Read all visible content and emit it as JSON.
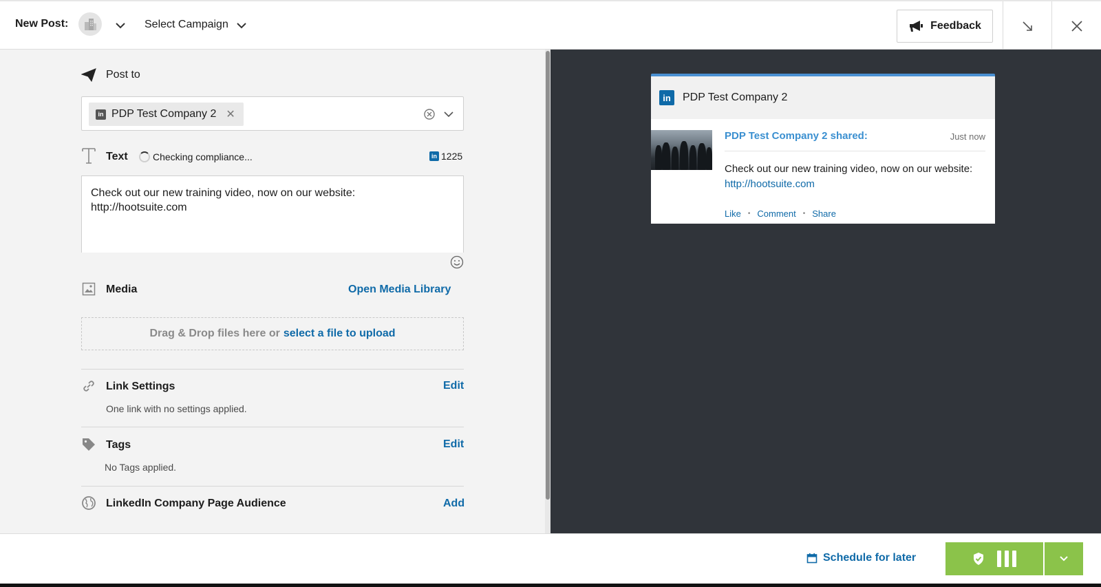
{
  "header": {
    "title": "New Post:",
    "avatar_icon": "building-icon",
    "campaign_label": "Select Campaign",
    "feedback_label": "Feedback"
  },
  "composer": {
    "post_to": {
      "label": "Post to",
      "selected_profile": "PDP Test Company 2"
    },
    "text": {
      "label": "Text",
      "compliance_status": "Checking compliance...",
      "char_count": "1225",
      "value": "Check out our new training video, now on our website:\nhttp://hootsuite.com"
    },
    "media": {
      "label": "Media",
      "library_link": "Open Media Library",
      "dropzone_text": "Drag & Drop files here or",
      "dropzone_link": "select a file to upload"
    },
    "link_settings": {
      "label": "Link Settings",
      "action": "Edit",
      "summary": "One link with no settings applied."
    },
    "tags": {
      "label": "Tags",
      "action": "Edit",
      "summary": "No Tags applied."
    },
    "audience": {
      "label": "LinkedIn Company Page Audience",
      "action": "Add"
    }
  },
  "preview": {
    "profile_name": "PDP Test Company 2",
    "shared_text": "PDP Test Company 2 shared:",
    "time": "Just now",
    "body": "Check out our new training video, now on our website:",
    "url": "http://hootsuite.com",
    "actions": [
      "Like",
      "Comment",
      "Share"
    ]
  },
  "footer": {
    "schedule_label": "Schedule for later"
  },
  "colors": {
    "accent_blue": "#0f6aa8",
    "preview_bg": "#30343a",
    "primary_green": "#8bc34a",
    "linkedin_blue": "#0f6aa8"
  }
}
